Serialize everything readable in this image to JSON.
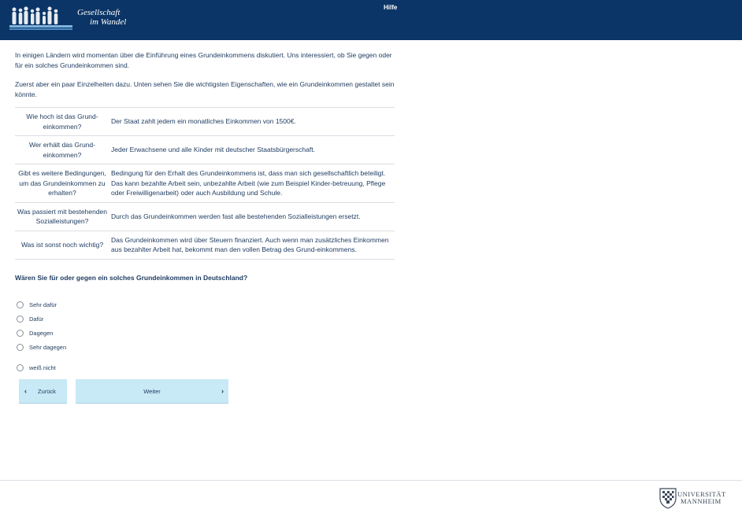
{
  "header": {
    "logo_line1": "Gesellschaft",
    "logo_line2": "im Wandel",
    "help_label": "Hilfe",
    "background_color": "#0b3566"
  },
  "intro": {
    "paragraph1": "In einigen Ländern wird momentan über die Einführung eines Grundeinkommens diskutiert. Uns interessiert, ob Sie gegen oder für ein solches Grundeinkommen sind.",
    "paragraph2": "Zuerst aber ein paar Einzelheiten dazu. Unten sehen Sie die wichtigsten Eigenschaften, wie ein Grundeinkommen gestaltet sein könnte."
  },
  "properties": [
    {
      "q": "Wie hoch ist das Grund-einkommen?",
      "a": "Der Staat zahlt jedem ein monatliches Einkommen von 1500€."
    },
    {
      "q": "Wer erhält das Grund-einkommen?",
      "a": "Jeder Erwachsene und alle Kinder mit deutscher Staatsbürgerschaft."
    },
    {
      "q": "Gibt es weitere Bedingungen, um das Grundeinkommen zu erhalten?",
      "a": "Bedingung für den Erhalt des Grundeinkommens ist, dass man sich gesellschaftlich beteiligt. Das kann bezahlte Arbeit sein, unbezahlte Arbeit (wie zum Beispiel Kinder-betreuung, Pflege oder Freiwilligenarbeit) oder auch Ausbildung und Schule."
    },
    {
      "q": "Was passiert mit bestehenden Sozialleistungen?",
      "a": "Durch das Grundeinkommen werden fast alle bestehenden Sozialleistungen ersetzt."
    },
    {
      "q": "Was ist sonst noch wichtig?",
      "a": "Das Grundeinkommen wird über Steuern finanziert. Auch wenn man zusätzliches Einkommen aus bezahlter Arbeit hat, bekommt man den vollen Betrag des Grund-einkommens."
    }
  ],
  "question": "Wären Sie für oder gegen ein solches Grundeinkommen in Deutschland?",
  "options": [
    "Sehr dafür",
    "Dafür",
    "Dagegen",
    "Sehr dagegen",
    "weiß nicht"
  ],
  "buttons": {
    "back_label": "Zurück",
    "next_label": "Weiter",
    "back_icon": "chevron-left-icon",
    "next_icon": "chevron-right-icon",
    "color": "#c8e9f6"
  },
  "footer": {
    "logo_line1": "UNIVERSITÄT",
    "logo_line2": "MANNHEIM"
  }
}
